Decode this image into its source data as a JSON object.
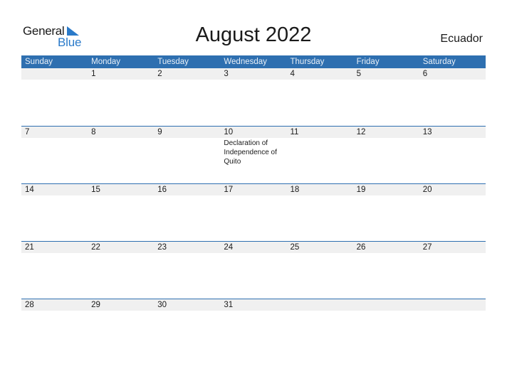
{
  "logo": {
    "text_general": "General",
    "text_blue": "Blue",
    "icon": "triangle-flag-icon",
    "brand_color": "#2a7ac9"
  },
  "title": "August 2022",
  "country": "Ecuador",
  "colors": {
    "header_bg": "#2e6fb0",
    "row_strip": "#f0f0f0"
  },
  "weekdays": [
    "Sunday",
    "Monday",
    "Tuesday",
    "Wednesday",
    "Thursday",
    "Friday",
    "Saturday"
  ],
  "weeks": [
    [
      {
        "day": ""
      },
      {
        "day": "1"
      },
      {
        "day": "2"
      },
      {
        "day": "3"
      },
      {
        "day": "4"
      },
      {
        "day": "5"
      },
      {
        "day": "6"
      }
    ],
    [
      {
        "day": "7"
      },
      {
        "day": "8"
      },
      {
        "day": "9"
      },
      {
        "day": "10",
        "event": "Declaration of Independence of Quito"
      },
      {
        "day": "11"
      },
      {
        "day": "12"
      },
      {
        "day": "13"
      }
    ],
    [
      {
        "day": "14"
      },
      {
        "day": "15"
      },
      {
        "day": "16"
      },
      {
        "day": "17"
      },
      {
        "day": "18"
      },
      {
        "day": "19"
      },
      {
        "day": "20"
      }
    ],
    [
      {
        "day": "21"
      },
      {
        "day": "22"
      },
      {
        "day": "23"
      },
      {
        "day": "24"
      },
      {
        "day": "25"
      },
      {
        "day": "26"
      },
      {
        "day": "27"
      }
    ],
    [
      {
        "day": "28"
      },
      {
        "day": "29"
      },
      {
        "day": "30"
      },
      {
        "day": "31"
      },
      {
        "day": ""
      },
      {
        "day": ""
      },
      {
        "day": ""
      }
    ]
  ]
}
